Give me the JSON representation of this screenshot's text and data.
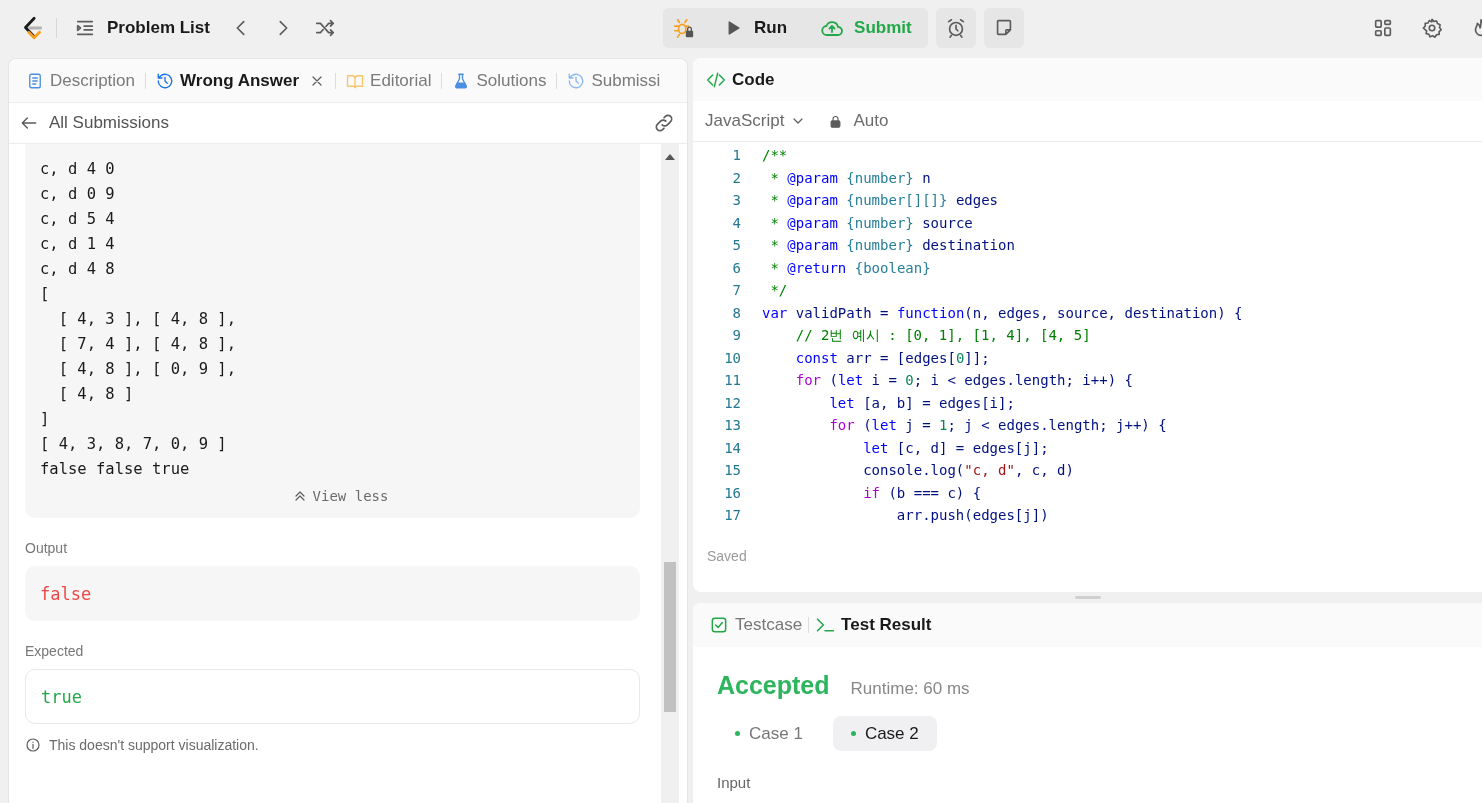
{
  "top_bar": {
    "title": "Problem List",
    "run_label": "Run",
    "submit_label": "Submit"
  },
  "left_tabs": [
    {
      "kind": "description",
      "label": "Description",
      "selected": false,
      "closable": false
    },
    {
      "kind": "result",
      "label": "Wrong Answer",
      "selected": true,
      "closable": true
    },
    {
      "kind": "editorial",
      "label": "Editorial",
      "selected": false,
      "closable": false
    },
    {
      "kind": "solutions",
      "label": "Solutions",
      "selected": false,
      "closable": false
    },
    {
      "kind": "submissions",
      "label": "Submissi",
      "selected": false,
      "closable": false
    }
  ],
  "back_link": "All Submissions",
  "stdout": {
    "lines": [
      "c, d 4 0",
      "c, d 0 9",
      "c, d 5 4",
      "c, d 1 4",
      "c, d 4 8",
      "[",
      "  [ 4, 3 ], [ 4, 8 ],",
      "  [ 7, 4 ], [ 4, 8 ],",
      "  [ 4, 8 ], [ 0, 9 ],",
      "  [ 4, 8 ]",
      "]",
      "[ 4, 3, 8, 7, 0, 9 ]",
      "false false true"
    ],
    "toggle": "View less"
  },
  "output": {
    "label": "Output",
    "value": "false"
  },
  "expected": {
    "label": "Expected",
    "value": "true"
  },
  "note": "This doesn't support visualization.",
  "editor": {
    "title": "Code",
    "language": "JavaScript",
    "mode": "Auto",
    "status": "Saved",
    "lines": [
      {
        "number": "1",
        "tokens": [
          {
            "kind": "cm",
            "text": "/**"
          }
        ]
      },
      {
        "number": "2",
        "tokens": [
          {
            "kind": "cm",
            "text": " * "
          },
          {
            "kind": "tag",
            "text": "@param"
          },
          {
            "kind": "typ",
            "text": " {number}"
          },
          {
            "kind": "txt",
            "text": " n"
          }
        ]
      },
      {
        "number": "3",
        "tokens": [
          {
            "kind": "cm",
            "text": " * "
          },
          {
            "kind": "tag",
            "text": "@param"
          },
          {
            "kind": "typ",
            "text": " {number[][]}"
          },
          {
            "kind": "txt",
            "text": " edges"
          }
        ]
      },
      {
        "number": "4",
        "tokens": [
          {
            "kind": "cm",
            "text": " * "
          },
          {
            "kind": "tag",
            "text": "@param"
          },
          {
            "kind": "typ",
            "text": " {number}"
          },
          {
            "kind": "txt",
            "text": " source"
          }
        ]
      },
      {
        "number": "5",
        "tokens": [
          {
            "kind": "cm",
            "text": " * "
          },
          {
            "kind": "tag",
            "text": "@param"
          },
          {
            "kind": "typ",
            "text": " {number}"
          },
          {
            "kind": "txt",
            "text": " destination"
          }
        ]
      },
      {
        "number": "6",
        "tokens": [
          {
            "kind": "cm",
            "text": " * "
          },
          {
            "kind": "tag",
            "text": "@return"
          },
          {
            "kind": "typ",
            "text": " {boolean}"
          }
        ]
      },
      {
        "number": "7",
        "tokens": [
          {
            "kind": "cm",
            "text": " */"
          }
        ]
      },
      {
        "number": "8",
        "tokens": [
          {
            "kind": "kw",
            "text": "var"
          },
          {
            "kind": "txt",
            "text": " validPath = "
          },
          {
            "kind": "kw",
            "text": "function"
          },
          {
            "kind": "txt",
            "text": "(n, edges, source, destination) {"
          }
        ]
      },
      {
        "number": "9",
        "tokens": [
          {
            "kind": "cm",
            "text": "    // 2번 예시 : [0, 1], [1, 4], [4, 5]"
          }
        ]
      },
      {
        "number": "10",
        "tokens": [
          {
            "kind": "kw",
            "text": "    const"
          },
          {
            "kind": "txt",
            "text": " arr = [edges["
          },
          {
            "kind": "num",
            "text": "0"
          },
          {
            "kind": "txt",
            "text": "]];"
          }
        ]
      },
      {
        "number": "11",
        "tokens": [
          {
            "kind": "ctl",
            "text": "    for"
          },
          {
            "kind": "txt",
            "text": " ("
          },
          {
            "kind": "kw",
            "text": "let"
          },
          {
            "kind": "txt",
            "text": " i = "
          },
          {
            "kind": "num",
            "text": "0"
          },
          {
            "kind": "txt",
            "text": "; i < edges.length; i++) {"
          }
        ]
      },
      {
        "number": "12",
        "tokens": [
          {
            "kind": "kw",
            "text": "        let"
          },
          {
            "kind": "txt",
            "text": " [a, b] = edges[i];"
          }
        ]
      },
      {
        "number": "13",
        "tokens": [
          {
            "kind": "ctl",
            "text": "        for"
          },
          {
            "kind": "txt",
            "text": " ("
          },
          {
            "kind": "kw",
            "text": "let"
          },
          {
            "kind": "txt",
            "text": " j = "
          },
          {
            "kind": "num",
            "text": "1"
          },
          {
            "kind": "txt",
            "text": "; j < edges.length; j++) {"
          }
        ]
      },
      {
        "number": "14",
        "tokens": [
          {
            "kind": "kw",
            "text": "            let"
          },
          {
            "kind": "txt",
            "text": " [c, d] = edges[j];"
          }
        ]
      },
      {
        "number": "15",
        "tokens": [
          {
            "kind": "txt",
            "text": "            console.log("
          },
          {
            "kind": "str",
            "text": "\"c, d\""
          },
          {
            "kind": "txt",
            "text": ", c, d)"
          }
        ]
      },
      {
        "number": "16",
        "tokens": [
          {
            "kind": "ctl",
            "text": "            if"
          },
          {
            "kind": "txt",
            "text": " (b === c) {"
          }
        ]
      },
      {
        "number": "17",
        "tokens": [
          {
            "kind": "txt",
            "text": "                arr.push(edges[j])"
          }
        ]
      }
    ]
  },
  "result_tabs": [
    {
      "kind": "testcase",
      "label": "Testcase",
      "selected": false
    },
    {
      "kind": "result",
      "label": "Test Result",
      "selected": true
    }
  ],
  "result": {
    "verdict": "Accepted",
    "runtime": "Runtime: 60 ms",
    "cases": [
      {
        "label": "Case 1",
        "selected": false
      },
      {
        "label": "Case 2",
        "selected": true
      }
    ],
    "input_label": "Input"
  }
}
